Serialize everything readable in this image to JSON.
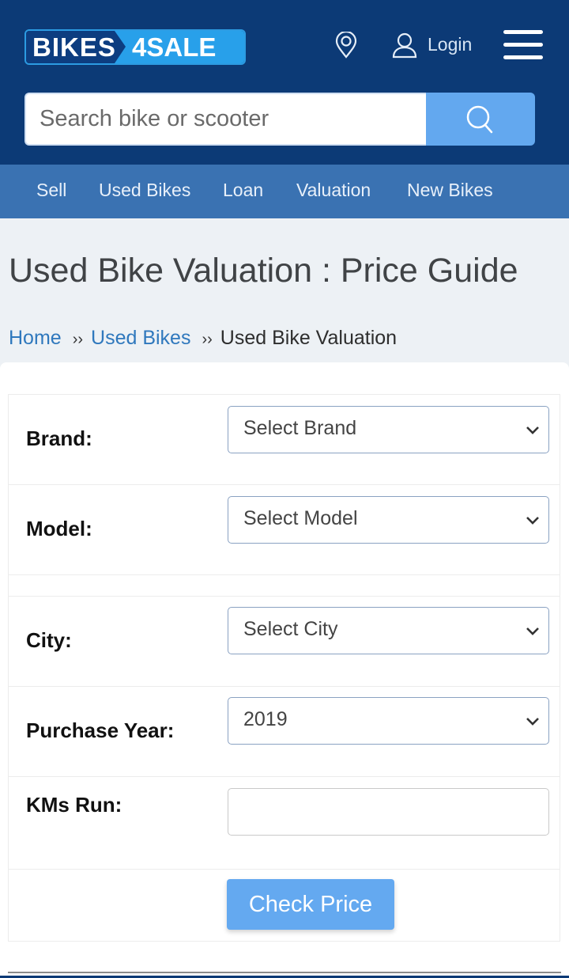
{
  "header": {
    "logo_left": "BIKES",
    "logo_right": "4SALE",
    "login_label": "Login",
    "icons": [
      "location-pin-icon",
      "user-icon",
      "hamburger-menu-icon",
      "search-icon"
    ]
  },
  "search": {
    "placeholder": "Search bike or scooter",
    "value": ""
  },
  "nav": {
    "items": [
      {
        "label": "Sell"
      },
      {
        "label": "Used Bikes"
      },
      {
        "label": "Loan"
      },
      {
        "label": "Valuation"
      },
      {
        "label": "New Bikes"
      }
    ]
  },
  "page": {
    "title": "Used Bike Valuation : Price Guide"
  },
  "breadcrumb": {
    "separator": "››",
    "items": [
      {
        "label": "Home",
        "link": true
      },
      {
        "label": "Used Bikes",
        "link": true
      },
      {
        "label": "Used Bike Valuation",
        "link": false
      }
    ]
  },
  "form": {
    "brand": {
      "label": "Brand:",
      "selected": "Select Brand"
    },
    "model": {
      "label": "Model:",
      "selected": "Select Model"
    },
    "city": {
      "label": "City:",
      "selected": "Select City"
    },
    "purchase_year": {
      "label": "Purchase Year:",
      "selected": "2019"
    },
    "kms_run": {
      "label": "KMs Run:",
      "value": "",
      "placeholder": ""
    },
    "submit_label": "Check Price"
  },
  "colors": {
    "header_bg": "#0c3a76",
    "nav_bg": "#3a72b2",
    "accent_button": "#64a9f0",
    "link": "#2f78bd",
    "page_bg": "#edf1f5"
  }
}
